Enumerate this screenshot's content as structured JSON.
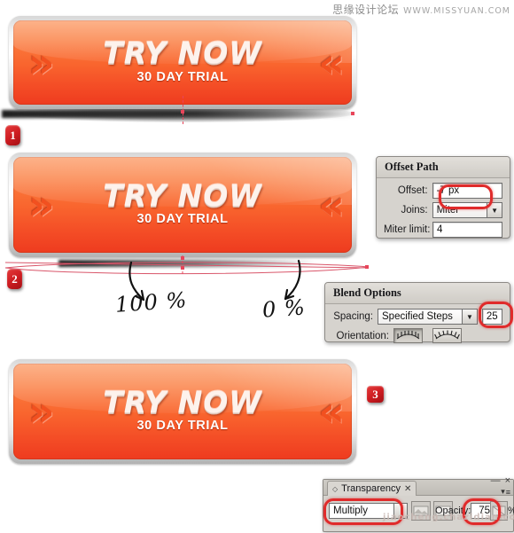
{
  "watermarks": {
    "top_cn": "思缘设计论坛",
    "top_url": "WWW.MISSYUAN.COM",
    "bottom_url": "jiaocheng.chazidian.com"
  },
  "button": {
    "main_label": "TRY NOW",
    "sub_label": "30 DAY TRIAL",
    "chevron_left": "»",
    "chevron_right": "«",
    "colors": {
      "orange_top": "#fb8a4c",
      "orange_bottom": "#ee3b1f",
      "bezel_light": "#ffffff",
      "bezel_dark": "#b2b2b2",
      "text": "#fdf2ec"
    }
  },
  "steps": [
    {
      "id": "step-1",
      "label": "1"
    },
    {
      "id": "step-2",
      "label": "2"
    },
    {
      "id": "step-3",
      "label": "3"
    }
  ],
  "annotations": {
    "left_percent": "100 %",
    "right_percent": "0 %",
    "guide_color": "#e8455a",
    "highlight_color": "#e02b2b"
  },
  "offset_path_dialog": {
    "title": "Offset Path",
    "offset_label": "Offset:",
    "offset_value": "-7 px",
    "joins_label": "Joins:",
    "joins_value": "Miter",
    "miter_limit_label": "Miter limit:",
    "miter_limit_value": "4"
  },
  "blend_options_dialog": {
    "title": "Blend Options",
    "spacing_label": "Spacing:",
    "spacing_value": "Specified Steps",
    "steps_value": "25",
    "orientation_label": "Orientation:",
    "orientation_align_page": "align-to-page",
    "orientation_align_path": "align-to-path"
  },
  "transparency_panel": {
    "tab_label": "Transparency",
    "blend_mode": "Multiply",
    "opacity_label": "Opacity:",
    "opacity_value": "75",
    "percent_sign": "%",
    "close_glyph": "×",
    "minimize_glyph": "—",
    "menu_glyph": "≡",
    "menu_caret": "▾",
    "tab_diamond": "◇",
    "tab_close": "✕"
  }
}
